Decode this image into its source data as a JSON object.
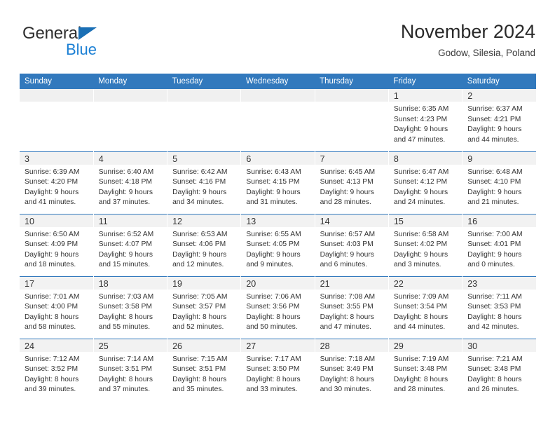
{
  "brand": {
    "name_part1": "General",
    "name_part2": "Blue",
    "triangle_color": "#1a6fb5",
    "blue_color": "#1a7fd4"
  },
  "header": {
    "title": "November 2024",
    "subtitle": "Godow, Silesia, Poland"
  },
  "theme": {
    "header_blue": "#3279bd",
    "daynum_band": "#f2f2f2",
    "text": "#333333"
  },
  "calendar": {
    "weekday_headers": [
      "Sunday",
      "Monday",
      "Tuesday",
      "Wednesday",
      "Thursday",
      "Friday",
      "Saturday"
    ],
    "weeks": [
      [
        {
          "day": "",
          "sunrise": "",
          "sunset": "",
          "daylight_line1": "",
          "daylight_line2": ""
        },
        {
          "day": "",
          "sunrise": "",
          "sunset": "",
          "daylight_line1": "",
          "daylight_line2": ""
        },
        {
          "day": "",
          "sunrise": "",
          "sunset": "",
          "daylight_line1": "",
          "daylight_line2": ""
        },
        {
          "day": "",
          "sunrise": "",
          "sunset": "",
          "daylight_line1": "",
          "daylight_line2": ""
        },
        {
          "day": "",
          "sunrise": "",
          "sunset": "",
          "daylight_line1": "",
          "daylight_line2": ""
        },
        {
          "day": "1",
          "sunrise": "Sunrise: 6:35 AM",
          "sunset": "Sunset: 4:23 PM",
          "daylight_line1": "Daylight: 9 hours",
          "daylight_line2": "and 47 minutes."
        },
        {
          "day": "2",
          "sunrise": "Sunrise: 6:37 AM",
          "sunset": "Sunset: 4:21 PM",
          "daylight_line1": "Daylight: 9 hours",
          "daylight_line2": "and 44 minutes."
        }
      ],
      [
        {
          "day": "3",
          "sunrise": "Sunrise: 6:39 AM",
          "sunset": "Sunset: 4:20 PM",
          "daylight_line1": "Daylight: 9 hours",
          "daylight_line2": "and 41 minutes."
        },
        {
          "day": "4",
          "sunrise": "Sunrise: 6:40 AM",
          "sunset": "Sunset: 4:18 PM",
          "daylight_line1": "Daylight: 9 hours",
          "daylight_line2": "and 37 minutes."
        },
        {
          "day": "5",
          "sunrise": "Sunrise: 6:42 AM",
          "sunset": "Sunset: 4:16 PM",
          "daylight_line1": "Daylight: 9 hours",
          "daylight_line2": "and 34 minutes."
        },
        {
          "day": "6",
          "sunrise": "Sunrise: 6:43 AM",
          "sunset": "Sunset: 4:15 PM",
          "daylight_line1": "Daylight: 9 hours",
          "daylight_line2": "and 31 minutes."
        },
        {
          "day": "7",
          "sunrise": "Sunrise: 6:45 AM",
          "sunset": "Sunset: 4:13 PM",
          "daylight_line1": "Daylight: 9 hours",
          "daylight_line2": "and 28 minutes."
        },
        {
          "day": "8",
          "sunrise": "Sunrise: 6:47 AM",
          "sunset": "Sunset: 4:12 PM",
          "daylight_line1": "Daylight: 9 hours",
          "daylight_line2": "and 24 minutes."
        },
        {
          "day": "9",
          "sunrise": "Sunrise: 6:48 AM",
          "sunset": "Sunset: 4:10 PM",
          "daylight_line1": "Daylight: 9 hours",
          "daylight_line2": "and 21 minutes."
        }
      ],
      [
        {
          "day": "10",
          "sunrise": "Sunrise: 6:50 AM",
          "sunset": "Sunset: 4:09 PM",
          "daylight_line1": "Daylight: 9 hours",
          "daylight_line2": "and 18 minutes."
        },
        {
          "day": "11",
          "sunrise": "Sunrise: 6:52 AM",
          "sunset": "Sunset: 4:07 PM",
          "daylight_line1": "Daylight: 9 hours",
          "daylight_line2": "and 15 minutes."
        },
        {
          "day": "12",
          "sunrise": "Sunrise: 6:53 AM",
          "sunset": "Sunset: 4:06 PM",
          "daylight_line1": "Daylight: 9 hours",
          "daylight_line2": "and 12 minutes."
        },
        {
          "day": "13",
          "sunrise": "Sunrise: 6:55 AM",
          "sunset": "Sunset: 4:05 PM",
          "daylight_line1": "Daylight: 9 hours",
          "daylight_line2": "and 9 minutes."
        },
        {
          "day": "14",
          "sunrise": "Sunrise: 6:57 AM",
          "sunset": "Sunset: 4:03 PM",
          "daylight_line1": "Daylight: 9 hours",
          "daylight_line2": "and 6 minutes."
        },
        {
          "day": "15",
          "sunrise": "Sunrise: 6:58 AM",
          "sunset": "Sunset: 4:02 PM",
          "daylight_line1": "Daylight: 9 hours",
          "daylight_line2": "and 3 minutes."
        },
        {
          "day": "16",
          "sunrise": "Sunrise: 7:00 AM",
          "sunset": "Sunset: 4:01 PM",
          "daylight_line1": "Daylight: 9 hours",
          "daylight_line2": "and 0 minutes."
        }
      ],
      [
        {
          "day": "17",
          "sunrise": "Sunrise: 7:01 AM",
          "sunset": "Sunset: 4:00 PM",
          "daylight_line1": "Daylight: 8 hours",
          "daylight_line2": "and 58 minutes."
        },
        {
          "day": "18",
          "sunrise": "Sunrise: 7:03 AM",
          "sunset": "Sunset: 3:58 PM",
          "daylight_line1": "Daylight: 8 hours",
          "daylight_line2": "and 55 minutes."
        },
        {
          "day": "19",
          "sunrise": "Sunrise: 7:05 AM",
          "sunset": "Sunset: 3:57 PM",
          "daylight_line1": "Daylight: 8 hours",
          "daylight_line2": "and 52 minutes."
        },
        {
          "day": "20",
          "sunrise": "Sunrise: 7:06 AM",
          "sunset": "Sunset: 3:56 PM",
          "daylight_line1": "Daylight: 8 hours",
          "daylight_line2": "and 50 minutes."
        },
        {
          "day": "21",
          "sunrise": "Sunrise: 7:08 AM",
          "sunset": "Sunset: 3:55 PM",
          "daylight_line1": "Daylight: 8 hours",
          "daylight_line2": "and 47 minutes."
        },
        {
          "day": "22",
          "sunrise": "Sunrise: 7:09 AM",
          "sunset": "Sunset: 3:54 PM",
          "daylight_line1": "Daylight: 8 hours",
          "daylight_line2": "and 44 minutes."
        },
        {
          "day": "23",
          "sunrise": "Sunrise: 7:11 AM",
          "sunset": "Sunset: 3:53 PM",
          "daylight_line1": "Daylight: 8 hours",
          "daylight_line2": "and 42 minutes."
        }
      ],
      [
        {
          "day": "24",
          "sunrise": "Sunrise: 7:12 AM",
          "sunset": "Sunset: 3:52 PM",
          "daylight_line1": "Daylight: 8 hours",
          "daylight_line2": "and 39 minutes."
        },
        {
          "day": "25",
          "sunrise": "Sunrise: 7:14 AM",
          "sunset": "Sunset: 3:51 PM",
          "daylight_line1": "Daylight: 8 hours",
          "daylight_line2": "and 37 minutes."
        },
        {
          "day": "26",
          "sunrise": "Sunrise: 7:15 AM",
          "sunset": "Sunset: 3:51 PM",
          "daylight_line1": "Daylight: 8 hours",
          "daylight_line2": "and 35 minutes."
        },
        {
          "day": "27",
          "sunrise": "Sunrise: 7:17 AM",
          "sunset": "Sunset: 3:50 PM",
          "daylight_line1": "Daylight: 8 hours",
          "daylight_line2": "and 33 minutes."
        },
        {
          "day": "28",
          "sunrise": "Sunrise: 7:18 AM",
          "sunset": "Sunset: 3:49 PM",
          "daylight_line1": "Daylight: 8 hours",
          "daylight_line2": "and 30 minutes."
        },
        {
          "day": "29",
          "sunrise": "Sunrise: 7:19 AM",
          "sunset": "Sunset: 3:48 PM",
          "daylight_line1": "Daylight: 8 hours",
          "daylight_line2": "and 28 minutes."
        },
        {
          "day": "30",
          "sunrise": "Sunrise: 7:21 AM",
          "sunset": "Sunset: 3:48 PM",
          "daylight_line1": "Daylight: 8 hours",
          "daylight_line2": "and 26 minutes."
        }
      ]
    ]
  }
}
